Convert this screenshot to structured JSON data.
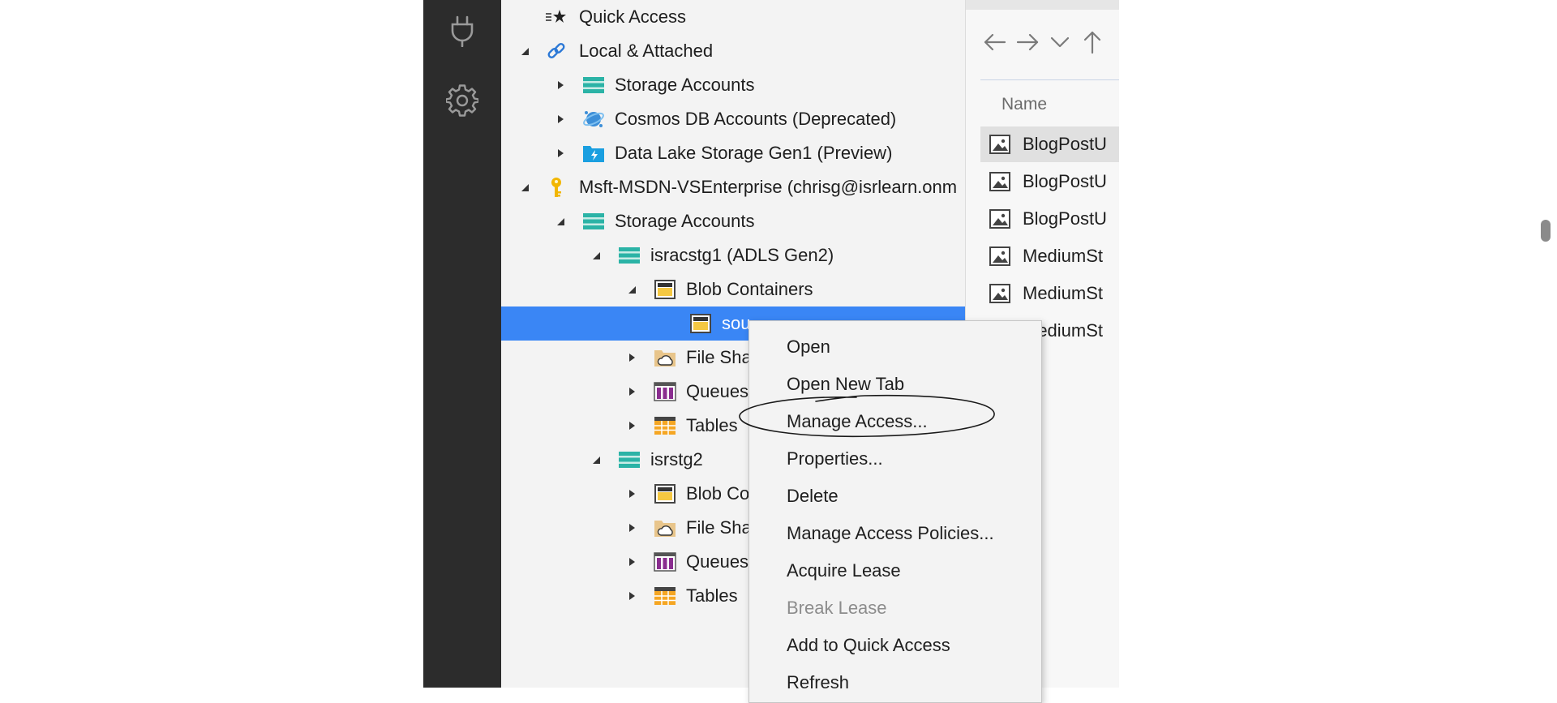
{
  "activity_bar": {
    "items": [
      {
        "icon": "plug-icon"
      },
      {
        "icon": "gear-icon"
      }
    ]
  },
  "tree": {
    "quick_access": "Quick Access",
    "local_attached": "Local & Attached",
    "local_storage_accounts": "Storage Accounts",
    "cosmos_db": "Cosmos DB Accounts (Deprecated)",
    "data_lake": "Data Lake Storage Gen1 (Preview)",
    "subscription": "Msft-MSDN-VSEnterprise (chrisg@isrlearn.onm",
    "sub_storage_accounts": "Storage Accounts",
    "account1": "isracstg1 (ADLS Gen2)",
    "account1_blob": "Blob Containers",
    "account1_selected_container": "sou",
    "account1_file_shares": "File Sha",
    "account1_queues": "Queues",
    "account1_tables": "Tables",
    "account2": "isrstg2",
    "account2_blob": "Blob Co",
    "account2_file_shares": "File Sha",
    "account2_queues": "Queues",
    "account2_tables": "Tables"
  },
  "explorer": {
    "nav_icons": [
      "back-arrow-icon",
      "forward-arrow-icon",
      "chevron-down-icon",
      "up-arrow-icon"
    ],
    "column_name": "Name",
    "files": [
      "BlogPostU",
      "BlogPostU",
      "BlogPostU",
      "MediumSt",
      "MediumSt",
      "MediumSt"
    ]
  },
  "context_menu": {
    "open": "Open",
    "open_new_tab": "Open New Tab",
    "manage_access": "Manage Access...",
    "properties": "Properties...",
    "delete": "Delete",
    "manage_access_policies": "Manage Access Policies...",
    "acquire_lease": "Acquire Lease",
    "break_lease": "Break Lease",
    "add_quick_access": "Add to Quick Access",
    "refresh": "Refresh"
  },
  "colors": {
    "activity_bar": "#2c2c2c",
    "selection": "#3a86f5",
    "tree_bg": "#f3f3f3"
  }
}
